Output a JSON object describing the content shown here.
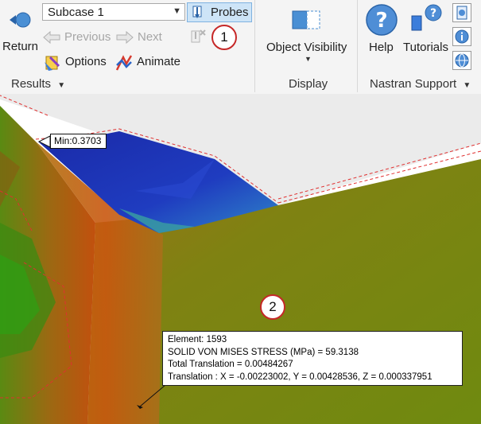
{
  "ribbon": {
    "results_group": {
      "return_label": "Return",
      "subcase_value": "Subcase 1",
      "probes_label": "Probes",
      "previous_label": "Previous",
      "next_label": "Next",
      "options_label": "Options",
      "animate_label": "Animate",
      "group_label": "Results"
    },
    "display_group": {
      "object_visibility_label": "Object Visibility",
      "group_label": "Display"
    },
    "nastran_group": {
      "help_label": "Help",
      "tutorials_label": "Tutorials",
      "group_label": "Nastran Support"
    }
  },
  "viewport": {
    "min_label": "Min:0.3703",
    "probe": {
      "element": "Element: 1593",
      "stress": "SOLID VON MISES STRESS (MPa)  = 59.3138",
      "total_translation": "Total Translation = 0.00484267",
      "translation": "Translation : X = -0.00223002, Y = 0.00428536, Z = 0.000337951"
    }
  },
  "callouts": [
    "1",
    "2"
  ],
  "colors": {
    "ribbon_bg": "#f4f4f4",
    "probes_active": "#cde4f7",
    "callout_ring": "#c62828",
    "stress_low": "#1b2fb0",
    "stress_mid": "#7a8a10",
    "stress_high": "#c8420e"
  },
  "icons": [
    "return-icon",
    "dropdown-arrow-icon",
    "probes-icon",
    "clear-probes-icon",
    "previous-arrow-icon",
    "next-arrow-icon",
    "options-icon",
    "animate-icon",
    "object-visibility-icon",
    "help-icon",
    "tutorials-icon",
    "info-document-icon",
    "info-icon",
    "globe-icon"
  ]
}
